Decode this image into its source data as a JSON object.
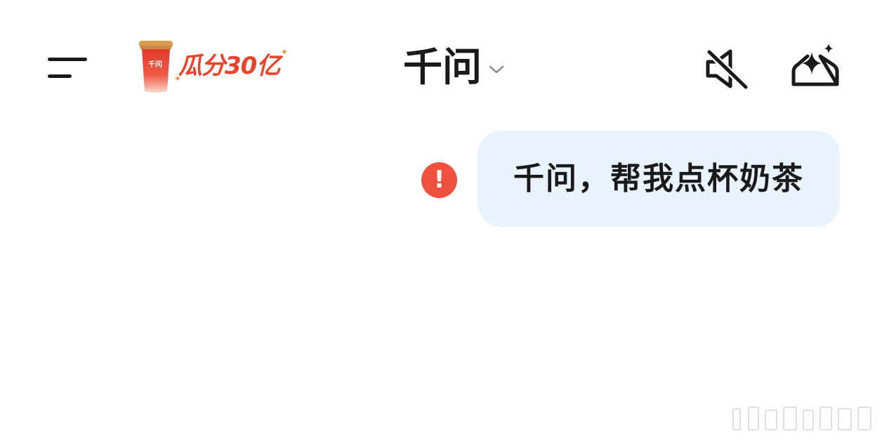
{
  "header": {
    "menu_icon": "menu-icon",
    "promo": {
      "cup_brand": "千问",
      "text": "瓜分30亿",
      "icon": "milk-tea-cup-icon",
      "color": "#e8432d"
    },
    "title": "千问",
    "title_dropdown_icon": "chevron-down-icon",
    "mute_icon": "speaker-muted-icon",
    "new_chat_icon": "new-chat-sparkle-icon"
  },
  "chat": {
    "messages": [
      {
        "role": "user",
        "text": "千问，帮我点杯奶茶",
        "status": "failed",
        "status_icon": "error-icon",
        "status_glyph": "!"
      }
    ],
    "bubble_color": "#e9f3fe",
    "error_color": "#f0513e"
  }
}
